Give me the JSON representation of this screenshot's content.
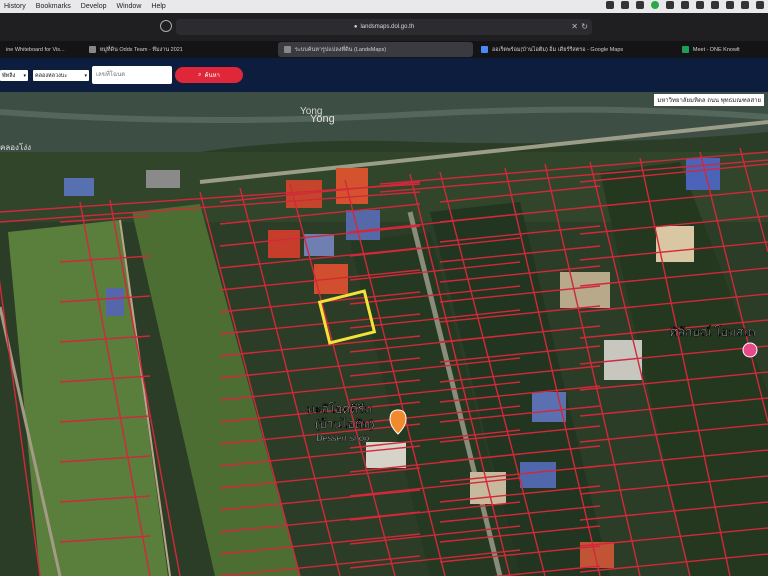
{
  "menubar": {
    "items": [
      "History",
      "Bookmarks",
      "Develop",
      "Window",
      "Help"
    ]
  },
  "browser": {
    "url": "landsmaps.dol.go.th",
    "tabs": [
      {
        "label": "ine Whiteboard for Vis...",
        "active": false
      },
      {
        "label": "หมู่ที่ดิน Odds Team - ทีมงาน 2021",
        "active": false
      },
      {
        "label": "ระบบค้นหารูปแปลงที่ดิน (LandsMaps)",
        "active": true
      },
      {
        "label": "ออเร็ตพร้อม(บ้านไอติม) อิ่ม เดียร์รีสตรอ - Google Maps",
        "active": false
      },
      {
        "label": "Meet - DNE Knowlt",
        "active": false
      }
    ]
  },
  "app": {
    "province_value": "พัทลิง",
    "district_value": "คลองหลวงบะ",
    "search_placeholder": "เลขที่โฉนด",
    "search_button_label": "ค้นหา"
  },
  "map": {
    "canal_labels": [
      "Yong",
      "Yong",
      "คลองโง่ง"
    ],
    "poi_name_line1": "มะลิโอดดีรีม",
    "poi_name_line2": "(บ้านไอติม)",
    "poi_name_line3": "Dessert shop",
    "right_poi_label": "ศิลักษณ์ โฮมสเต",
    "top_right_label": "มหาวิทยาลัยมหิดล ถนน พุทธมณฑลสาย"
  },
  "colors": {
    "parcel_line": "#d3283a",
    "highlight_parcel": "#f2e23a",
    "search_button": "#e02639",
    "app_bar": "#0d1d3d"
  }
}
